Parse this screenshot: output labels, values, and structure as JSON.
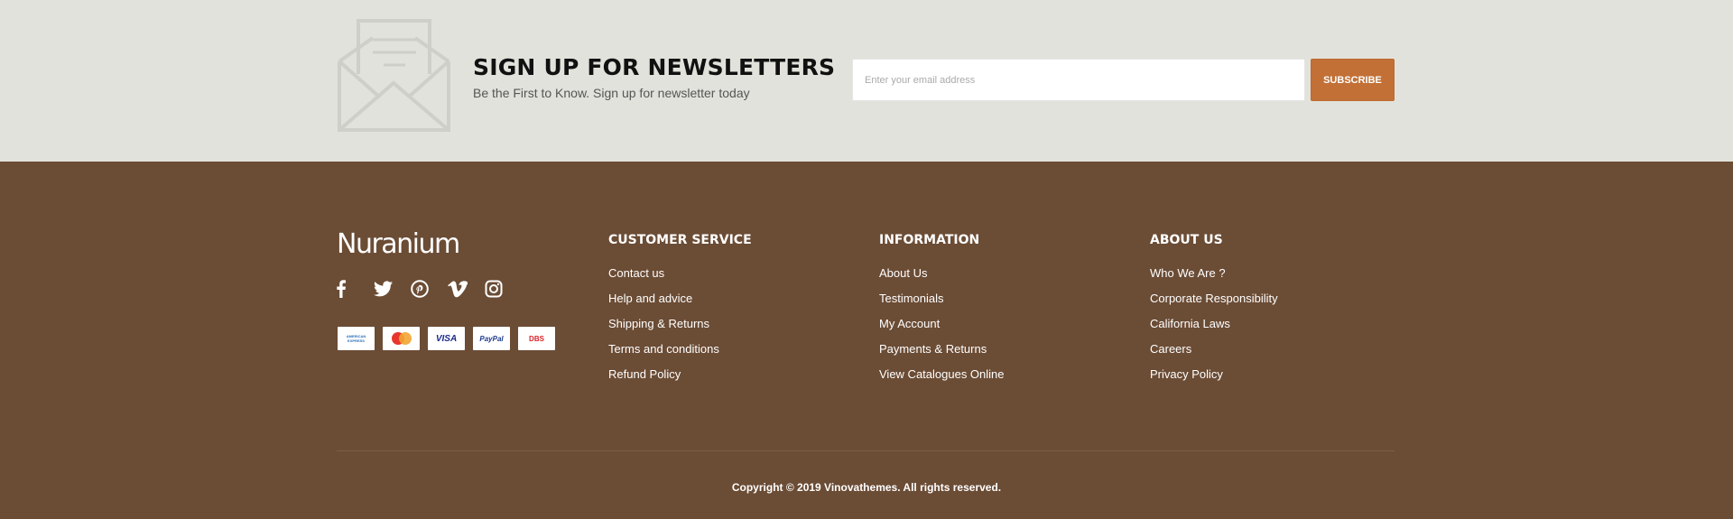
{
  "newsletter": {
    "title": "SIGN UP FOR NEWSLETTERS",
    "subtitle": "Be the First to Know. Sign up for newsletter today",
    "email_placeholder": "Enter your email address",
    "subscribe_label": "SUBSCRIBE",
    "icon": "envelope-icon"
  },
  "footer": {
    "brand": "Nuranium",
    "socials": [
      "facebook-icon",
      "twitter-icon",
      "pinterest-icon",
      "vimeo-icon",
      "instagram-icon"
    ],
    "payments": [
      "american-express",
      "mastercard",
      "visa",
      "paypal",
      "dbs"
    ],
    "payment_labels": {
      "amex": "AMERICAN EXPRESS",
      "visa": "VISA",
      "paypal": "PayPal",
      "dbs": "DBS"
    },
    "columns": [
      {
        "title": "CUSTOMER SERVICE",
        "links": [
          "Contact us",
          "Help and advice",
          "Shipping & Returns",
          "Terms and conditions",
          "Refund Policy"
        ]
      },
      {
        "title": "INFORMATION",
        "links": [
          "About Us",
          "Testimonials",
          "My Account",
          "Payments & Returns",
          "View Catalogues Online"
        ]
      },
      {
        "title": "ABOUT US",
        "links": [
          "Who We Are ?",
          "Corporate Responsibility",
          "California Laws",
          "Careers",
          "Privacy Policy"
        ]
      }
    ],
    "copyright": "Copyright © 2019 Vinovathemes. All rights reserved."
  },
  "colors": {
    "newsletter_bg": "#e2e2dc",
    "footer_bg": "#6b4c35",
    "accent": "#c27036"
  }
}
